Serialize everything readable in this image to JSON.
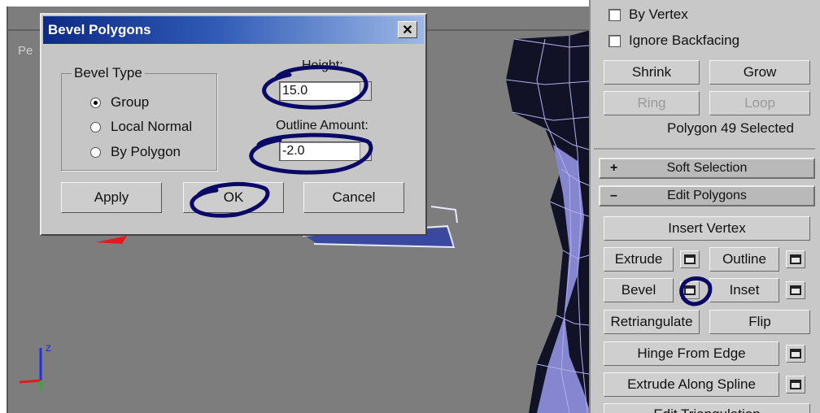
{
  "viewport": {
    "label": "Pe"
  },
  "dialog": {
    "title": "Bevel Polygons",
    "close_label": "✕",
    "bevel_type": {
      "legend": "Bevel Type",
      "options": [
        "Group",
        "Local Normal",
        "By Polygon"
      ],
      "selected": "Group"
    },
    "height_label": "Height:",
    "height_value": "15.0",
    "outline_label": "Outline Amount:",
    "outline_value": "-2.0",
    "apply_label": "Apply",
    "ok_label": "OK",
    "cancel_label": "Cancel"
  },
  "panel": {
    "by_vertex": "By Vertex",
    "ignore_backfacing": "Ignore Backfacing",
    "shrink": "Shrink",
    "grow": "Grow",
    "ring": "Ring",
    "loop": "Loop",
    "status": "Polygon 49 Selected",
    "soft_selection": {
      "sign": "+",
      "label": "Soft Selection"
    },
    "edit_polygons": {
      "sign": "–",
      "label": "Edit Polygons"
    },
    "insert_vertex": "Insert Vertex",
    "extrude": "Extrude",
    "outline": "Outline",
    "bevel": "Bevel",
    "inset": "Inset",
    "retriangulate": "Retriangulate",
    "flip": "Flip",
    "hinge_from_edge": "Hinge From Edge",
    "extrude_along_spline": "Extrude Along Spline",
    "edit_triangulation": "Edit Triangulation"
  },
  "colors": {
    "titlebar_start": "#0d2a86",
    "titlebar_end": "#9db8e6",
    "viewport_bg": "#7d7d7d",
    "annotation_ink": "#0a0a66"
  },
  "icons": {
    "settings_box": "settings-box-icon",
    "close": "close-icon",
    "radio": "radio-icon",
    "checkbox": "checkbox-icon"
  }
}
